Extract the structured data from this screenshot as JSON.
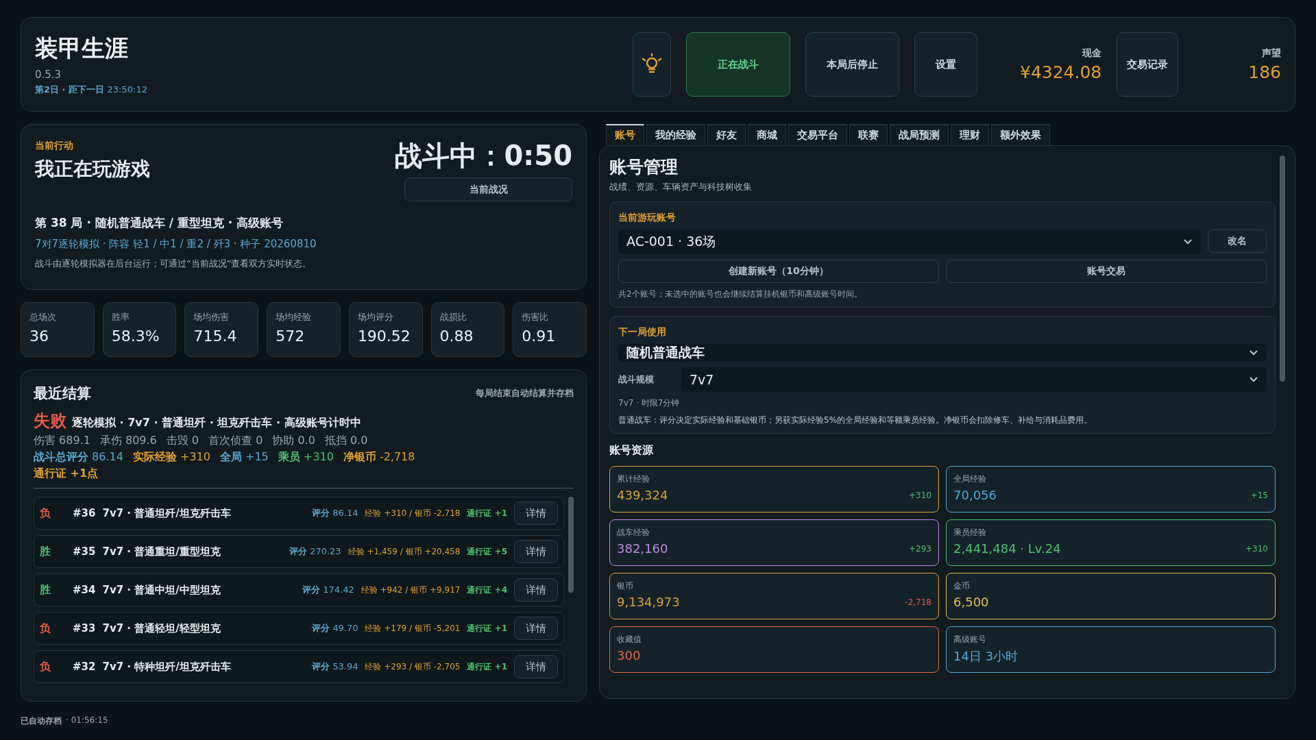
{
  "app": {
    "title": "装甲生涯",
    "version": "0.5.3",
    "day": "第2日 · 距下一日",
    "countdown": "23:50:12"
  },
  "header": {
    "buttons": [
      {
        "kind": "icon"
      },
      {
        "kind": "primary",
        "label": "正在战斗",
        "selected": true
      },
      {
        "kind": "plain",
        "label": "本局后停止",
        "selected": false
      },
      {
        "kind": "plain",
        "label": "设置",
        "selected": false
      }
    ],
    "cash": {
      "label": "现金",
      "value": "¥4324.08"
    },
    "trade_button": "交易记录",
    "reputation": {
      "label": "声望",
      "value": "186"
    }
  },
  "action": {
    "label": "当前行动",
    "title": "我正在玩游戏",
    "timer": "战斗中：0:50",
    "status_button": "当前战况",
    "match": "第 38 局 · 随机普通战车 / 重型坦克 · 高级账号",
    "detail": "7对7逐轮模拟 · 阵容 轻1 / 中1 / 重2 / 歼3 · 种子 20260810",
    "note": "战斗由逐轮模拟器在后台运行；可通过“当前战况”查看双方实时状态。"
  },
  "stats": [
    {
      "label": "总场次",
      "value": "36"
    },
    {
      "label": "胜率",
      "value": "58.3%"
    },
    {
      "label": "场均伤害",
      "value": "715.4"
    },
    {
      "label": "场均经验",
      "value": "572"
    },
    {
      "label": "场均评分",
      "value": "190.52"
    },
    {
      "label": "战损比",
      "value": "0.88"
    },
    {
      "label": "伤害比",
      "value": "0.91"
    }
  ],
  "recent": {
    "title": "最近结算",
    "hint": "每局结束自动结算并存档",
    "latest": {
      "outcome": "失败",
      "win": false,
      "summary": "逐轮模拟 · 7v7 · 普通坦歼 · 坦克歼击车 · 高级账号计时中",
      "stats": [
        {
          "label": "伤害",
          "value": "689.1"
        },
        {
          "label": "承伤",
          "value": "809.6"
        },
        {
          "label": "击毁",
          "value": "0"
        },
        {
          "label": "首次侦查",
          "value": "0"
        },
        {
          "label": "协助",
          "value": "0.0"
        },
        {
          "label": "抵挡",
          "value": "0.0"
        }
      ],
      "rewards": [
        {
          "label": "战斗总评分",
          "value": "86.14",
          "color": "#5aa8d0"
        },
        {
          "label": "实际经验",
          "value": "+310",
          "color": "#e0a030"
        },
        {
          "label": "全局",
          "value": "+15",
          "color": "#5aa8d0"
        },
        {
          "label": "乘员",
          "value": "+310",
          "color": "#4cc070"
        },
        {
          "label": "净银币",
          "value": "-2,718",
          "color": "#e0a030"
        }
      ],
      "pass": "通行证 +1点"
    },
    "rows": [
      {
        "result": "负",
        "win": false,
        "number": "#36",
        "title": "7v7 · 普通坦歼/坦克歼击车",
        "score_label": "评分",
        "score": "86.14",
        "rewards": "经验 +310 / 银币 -2,718",
        "pass": "通行证 +1",
        "button": "详情"
      },
      {
        "result": "胜",
        "win": true,
        "number": "#35",
        "title": "7v7 · 普通重坦/重型坦克",
        "score_label": "评分",
        "score": "270.23",
        "rewards": "经验 +1,459 / 银币 +20,458",
        "pass": "通行证 +5",
        "button": "详情"
      },
      {
        "result": "胜",
        "win": true,
        "number": "#34",
        "title": "7v7 · 普通中坦/中型坦克",
        "score_label": "评分",
        "score": "174.42",
        "rewards": "经验 +942 / 银币 +9,917",
        "pass": "通行证 +4",
        "button": "详情"
      },
      {
        "result": "负",
        "win": false,
        "number": "#33",
        "title": "7v7 · 普通轻坦/轻型坦克",
        "score_label": "评分",
        "score": "49.70",
        "rewards": "经验 +179 / 银币 -5,201",
        "pass": "通行证 +1",
        "button": "详情"
      },
      {
        "result": "负",
        "win": false,
        "number": "#32",
        "title": "7v7 · 特种坦歼/坦克歼击车",
        "score_label": "评分",
        "score": "53.94",
        "rewards": "经验 +293 / 银币 -2,705",
        "pass": "通行证 +1",
        "button": "详情"
      }
    ]
  },
  "status_bar": {
    "saved": "已自动存档",
    "time": "· 01:56:15"
  },
  "tabs": [
    {
      "label": "账号",
      "selected": true
    },
    {
      "label": "我的经验",
      "selected": false
    },
    {
      "label": "好友",
      "selected": false
    },
    {
      "label": "商城",
      "selected": false
    },
    {
      "label": "交易平台",
      "selected": false
    },
    {
      "label": "联赛",
      "selected": false
    },
    {
      "label": "战局预测",
      "selected": false
    },
    {
      "label": "理财",
      "selected": false
    },
    {
      "label": "额外效果",
      "selected": false
    }
  ],
  "account": {
    "title": "账号管理",
    "subtitle": "战绩、资源、车辆资产与科技树收集",
    "current": {
      "label": "当前游玩账号",
      "value": "AC-001 · 36场",
      "rename": "改名",
      "create": "创建新账号（10分钟）",
      "trade": "账号交易",
      "note": "共2个账号；未选中的账号也会继续结算挂机银币和高级账号时间。"
    },
    "next": {
      "label": "下一局使用",
      "mode": "随机普通战车",
      "scale_label": "战斗规模",
      "scale": "7v7",
      "scale_note": "7v7 · 时限7分钟",
      "note": "普通战车：评分决定实际经验和基础银币；另获实际经验5%的全局经验和等额乘员经验。净银币会扣除修车、补给与消耗品费用。"
    },
    "resources_title": "账号资源",
    "resources": [
      {
        "label": "累计经验",
        "value": "439,324",
        "delta": {
          "text": "+310",
          "color": "#4cc070"
        },
        "color": "#d9a23a"
      },
      {
        "label": "全局经验",
        "value": "70,056",
        "delta": {
          "text": "+15",
          "color": "#4cc070"
        },
        "color": "#5aa8d0"
      },
      {
        "label": "战车经验",
        "value": "382,160",
        "delta": {
          "text": "+293",
          "color": "#4cc070"
        },
        "color": "#c08ae0"
      },
      {
        "label": "乘员经验",
        "value": "2,441,484 · Lv.24",
        "delta": {
          "text": "+310",
          "color": "#4cc070"
        },
        "color": "#4cc070"
      },
      {
        "label": "银币",
        "value": "9,134,973",
        "delta": {
          "text": "-2,718",
          "color": "#e05a4a"
        },
        "color": "#d9a23a"
      },
      {
        "label": "金币",
        "value": "6,500",
        "color": "#e0c050"
      },
      {
        "label": "收藏值",
        "value": "300",
        "color": "#e06a4a"
      },
      {
        "label": "高级账号",
        "value": "14日 3小时",
        "color": "#5aa8d0"
      }
    ]
  }
}
